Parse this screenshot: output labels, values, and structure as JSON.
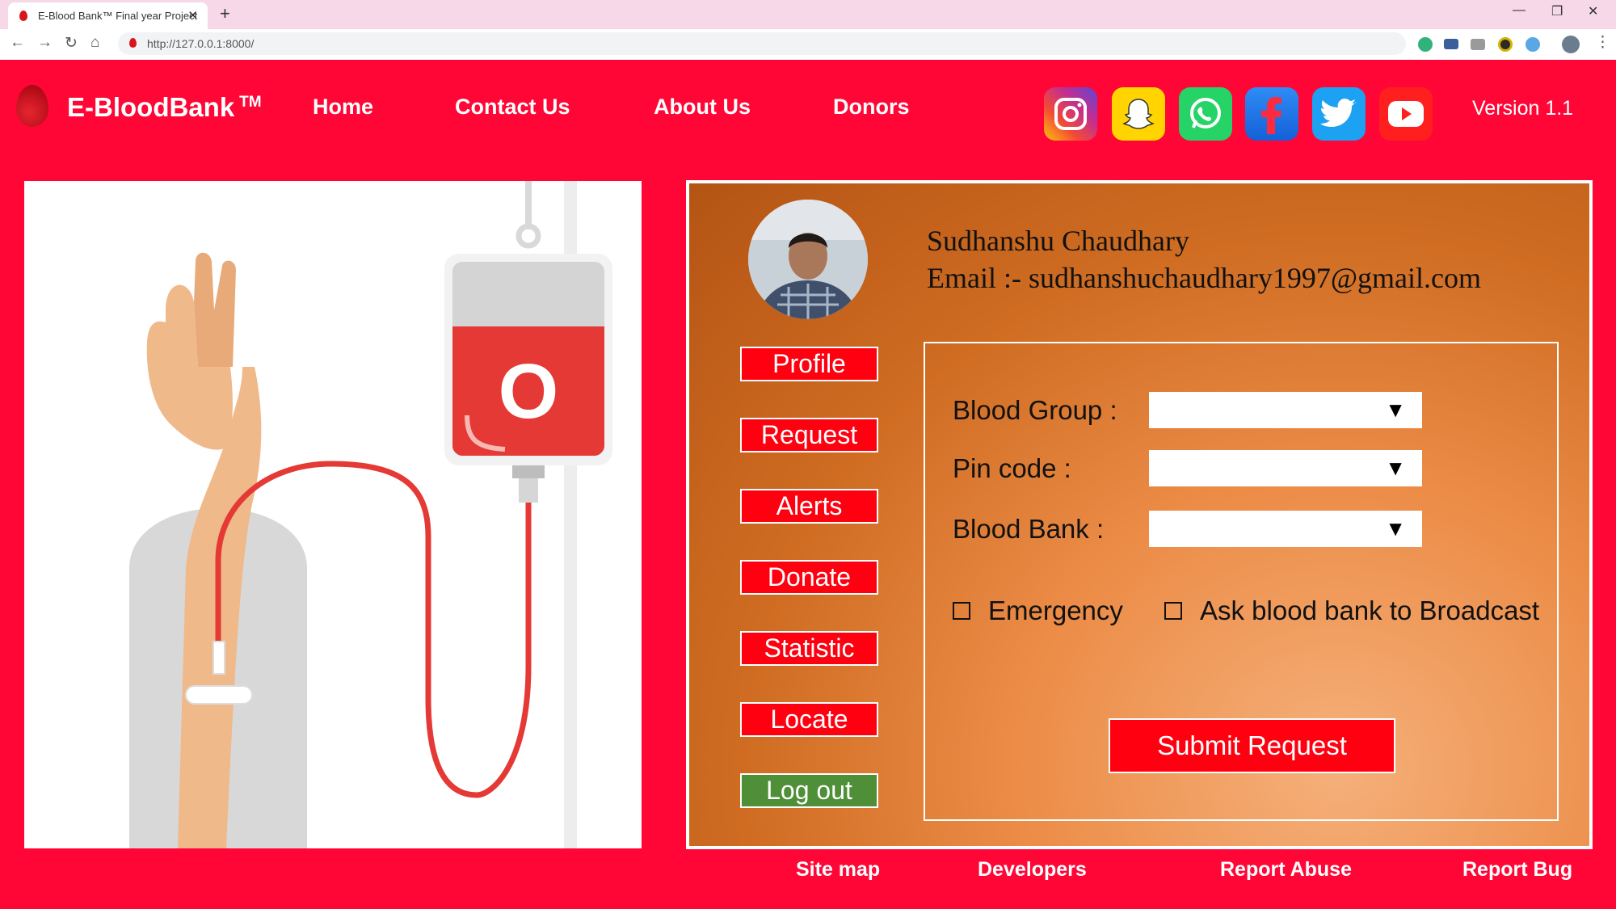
{
  "browser": {
    "tab_title": "E-Blood Bank™ Final year Project",
    "url": "http://127.0.0.1:8000/"
  },
  "site": {
    "brand": "E-BloodBank",
    "trademark": "TM",
    "nav": [
      "Home",
      "Contact Us",
      "About Us",
      "Donors"
    ],
    "social": [
      "instagram-icon",
      "snapchat-icon",
      "whatsapp-icon",
      "facebook-icon",
      "twitter-icon",
      "youtube-icon"
    ],
    "version": "Version 1.1",
    "colors": {
      "background": "#ff0636",
      "button": "#ff0010",
      "logout": "#4e8f37"
    }
  },
  "illustration": {
    "bag_label": "O"
  },
  "profile": {
    "name": "Sudhanshu Chaudhary",
    "email_line": "Email :- sudhanshuchaudhary1997@gmail.com"
  },
  "sidebar": {
    "items": [
      "Profile",
      "Request",
      "Alerts",
      "Donate",
      "Statistic",
      "Locate"
    ],
    "logout": "Log out"
  },
  "form": {
    "blood_group_label": "Blood Group :",
    "pincode_label": "Pin code :",
    "blood_bank_label": "Blood Bank :",
    "blood_group_value": "",
    "pincode_value": "",
    "blood_bank_value": "",
    "emergency_label": "Emergency",
    "broadcast_label": "Ask blood bank to Broadcast",
    "submit_label": "Submit Request"
  },
  "footer": [
    "Site map",
    "Developers",
    "Report Abuse",
    "Report Bug"
  ]
}
